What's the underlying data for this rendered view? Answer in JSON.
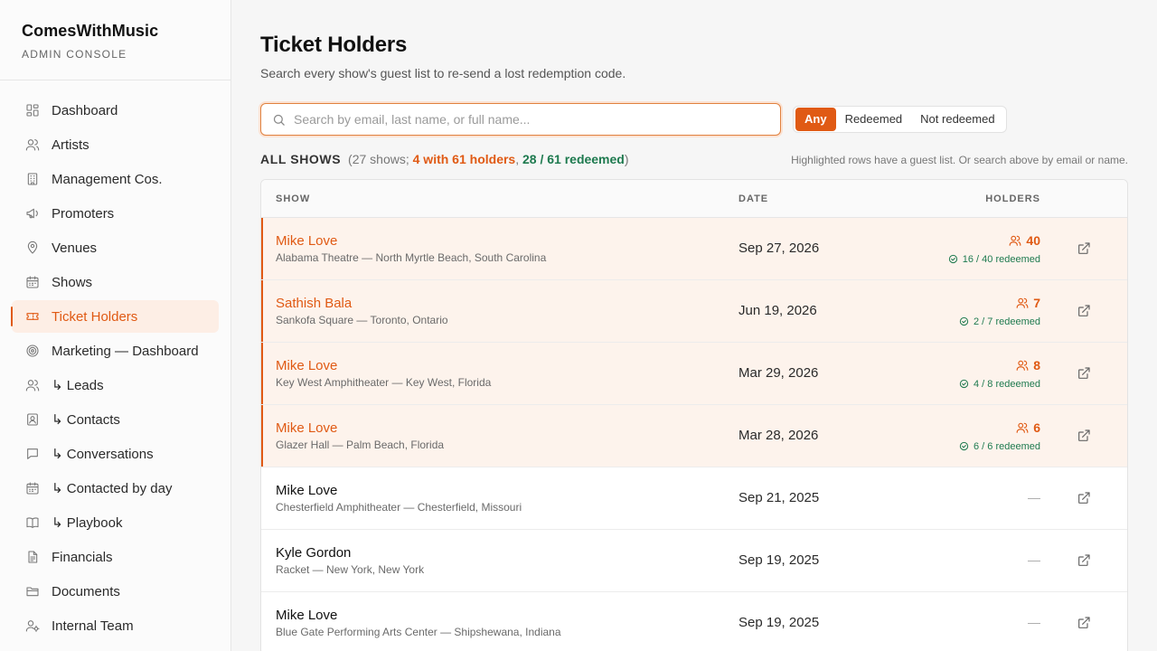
{
  "brand": {
    "name": "ComesWithMusic",
    "subtitle": "ADMIN CONSOLE"
  },
  "nav": [
    {
      "label": "Dashboard",
      "icon": "dashboard-icon"
    },
    {
      "label": "Artists",
      "icon": "users-icon"
    },
    {
      "label": "Management Cos.",
      "icon": "building-icon"
    },
    {
      "label": "Promoters",
      "icon": "megaphone-icon"
    },
    {
      "label": "Venues",
      "icon": "map-pin-icon"
    },
    {
      "label": "Shows",
      "icon": "calendar-icon"
    },
    {
      "label": "Ticket Holders",
      "icon": "ticket-icon",
      "active": true
    },
    {
      "label": "Marketing — Dashboard",
      "icon": "target-icon"
    },
    {
      "label": "↳ Leads",
      "icon": "users-icon"
    },
    {
      "label": "↳ Contacts",
      "icon": "contact-card-icon"
    },
    {
      "label": "↳ Conversations",
      "icon": "chat-bubble-icon"
    },
    {
      "label": "↳ Contacted by day",
      "icon": "calendar-icon"
    },
    {
      "label": "↳ Playbook",
      "icon": "book-icon"
    },
    {
      "label": "Financials",
      "icon": "file-text-icon"
    },
    {
      "label": "Documents",
      "icon": "folder-icon"
    },
    {
      "label": "Internal Team",
      "icon": "user-cog-icon"
    }
  ],
  "page": {
    "title": "Ticket Holders",
    "subtitle": "Search every show's guest list to re-send a lost redemption code."
  },
  "search": {
    "placeholder": "Search by email, last name, or full name...",
    "value": ""
  },
  "filters": [
    {
      "label": "Any",
      "active": true
    },
    {
      "label": "Redeemed",
      "active": false
    },
    {
      "label": "Not redeemed",
      "active": false
    }
  ],
  "summary": {
    "heading": "ALL SHOWS",
    "open": "(27 shows; ",
    "with_holders": "4 with 61 holders",
    "sep": ", ",
    "redeemed": "28 / 61 redeemed",
    "close": ")",
    "hint": "Highlighted rows have a guest list. Or search above by email or name."
  },
  "table": {
    "headers": {
      "show": "SHOW",
      "date": "DATE",
      "holders": "HOLDERS"
    },
    "rows": [
      {
        "title": "Mike Love",
        "venue": "Alabama Theatre — North Myrtle Beach, South Carolina",
        "date": "Sep 27, 2026",
        "holders": "40",
        "redeemed": "16 / 40 redeemed",
        "highlighted": true
      },
      {
        "title": "Sathish Bala",
        "venue": "Sankofa Square — Toronto, Ontario",
        "date": "Jun 19, 2026",
        "holders": "7",
        "redeemed": "2 / 7 redeemed",
        "highlighted": true
      },
      {
        "title": "Mike Love",
        "venue": "Key West Amphitheater — Key West, Florida",
        "date": "Mar 29, 2026",
        "holders": "8",
        "redeemed": "4 / 8 redeemed",
        "highlighted": true
      },
      {
        "title": "Mike Love",
        "venue": "Glazer Hall — Palm Beach, Florida",
        "date": "Mar 28, 2026",
        "holders": "6",
        "redeemed": "6 / 6 redeemed",
        "highlighted": true
      },
      {
        "title": "Mike Love",
        "venue": "Chesterfield Amphitheater — Chesterfield, Missouri",
        "date": "Sep 21, 2025",
        "holders": "—",
        "redeemed": "",
        "highlighted": false
      },
      {
        "title": "Kyle Gordon",
        "venue": "Racket — New York, New York",
        "date": "Sep 19, 2025",
        "holders": "—",
        "redeemed": "",
        "highlighted": false
      },
      {
        "title": "Mike Love",
        "venue": "Blue Gate Performing Arts Center — Shipshewana, Indiana",
        "date": "Sep 19, 2025",
        "holders": "—",
        "redeemed": "",
        "highlighted": false
      }
    ]
  },
  "colors": {
    "accent": "#e05a14",
    "success": "#1e7a4f",
    "highlight_bg": "#fdf3ec"
  }
}
